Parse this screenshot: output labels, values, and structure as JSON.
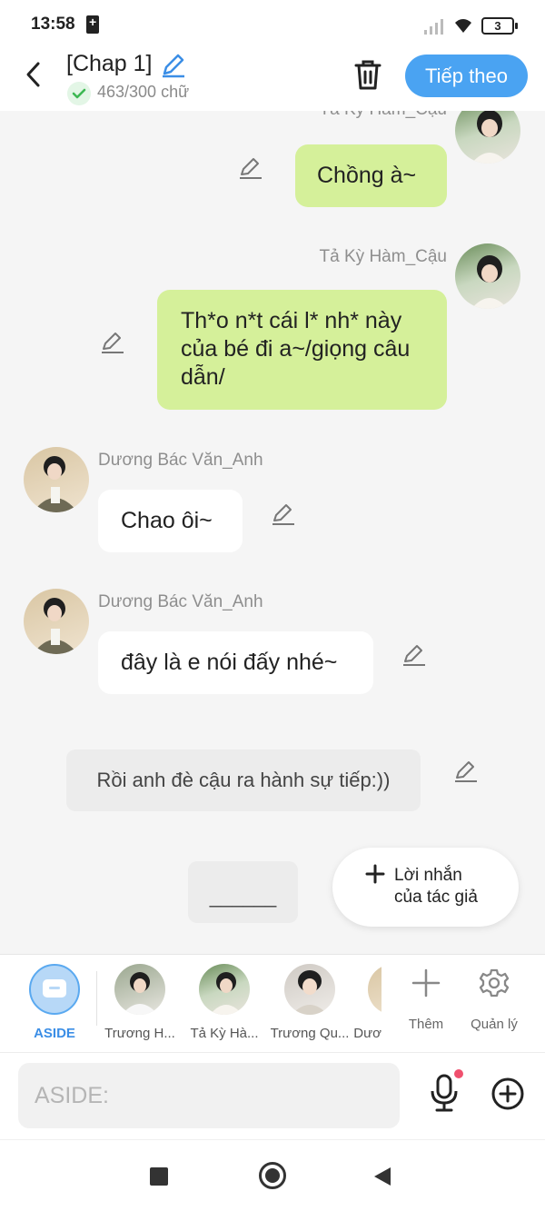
{
  "status_bar": {
    "time": "13:58",
    "battery": "3"
  },
  "header": {
    "title": "[Chap 1]",
    "word_count": "463/300 chữ",
    "next_button": "Tiếp theo"
  },
  "messages": [
    {
      "sender": "Tả Kỳ Hàm_Cậu",
      "text": "Chồng à~",
      "side": "right",
      "style": "green"
    },
    {
      "sender": "Tả Kỳ Hàm_Cậu",
      "text": "Th*o n*t cái l* nh* này của bé đi a~/giọng câu dẫn/",
      "side": "right",
      "style": "green"
    },
    {
      "sender": "Dương Bác Văn_Anh",
      "text": "Chao ôi~",
      "side": "left",
      "style": "white"
    },
    {
      "sender": "Dương Bác Văn_Anh",
      "text": "đây là e nói đấy nhé~",
      "side": "left",
      "style": "white"
    },
    {
      "sender": "",
      "text": "Rồi anh đè cậu ra hành sự tiếp:))",
      "side": "center",
      "style": "gray"
    },
    {
      "sender": "",
      "text": "______",
      "side": "center",
      "style": "gray"
    }
  ],
  "author_note": {
    "line1": "Lời nhắn",
    "line2": "của tác giả"
  },
  "character_bar": {
    "aside_label": "ASIDE",
    "characters": [
      {
        "label": "Trương H..."
      },
      {
        "label": "Tả Kỳ Hà..."
      },
      {
        "label": "Trương Qu..."
      },
      {
        "label": "Dươ"
      }
    ],
    "add_label": "Thêm",
    "manage_label": "Quản lý"
  },
  "input": {
    "placeholder": "ASIDE:"
  },
  "colors": {
    "accent": "#4aa3f2",
    "bubble_green": "#d5f09a",
    "bubble_white": "#ffffff",
    "gray_note": "#ececec"
  }
}
